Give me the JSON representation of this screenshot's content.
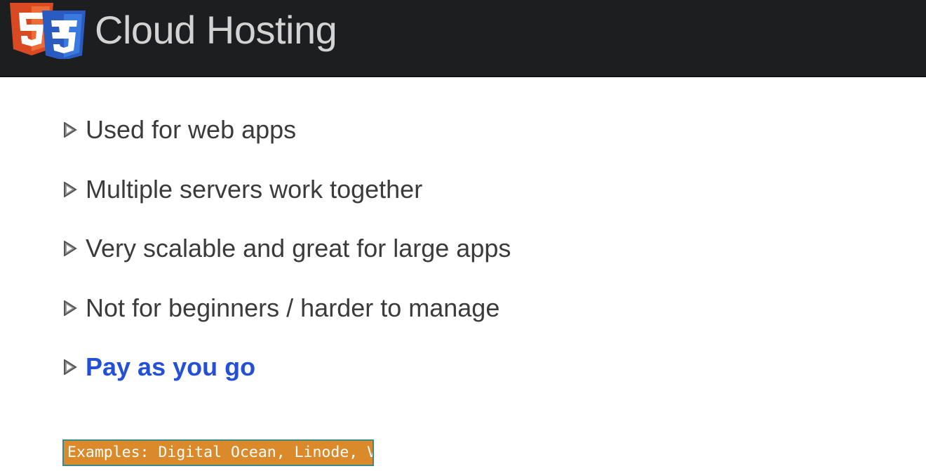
{
  "header": {
    "title": "Cloud Hosting",
    "logo_icon": "html5-css3-logo-icon",
    "background_color": "#1d1e20",
    "title_color": "#d3d3d3"
  },
  "bullets": {
    "icon": "triangle-bullet-icon",
    "items": [
      {
        "text": "Used for web apps",
        "emphasized": false
      },
      {
        "text": "Multiple servers work together",
        "emphasized": false
      },
      {
        "text": "Very scalable and great for large apps",
        "emphasized": false
      },
      {
        "text": "Not for beginners / harder to manage",
        "emphasized": false
      },
      {
        "text": "Pay as you go",
        "emphasized": true
      }
    ],
    "text_color": "#3b3b3b",
    "emphasis_color": "#2450d8"
  },
  "note": {
    "text": "Examples: Digital Ocean, Linode, Vultr",
    "background_color": "#da8a2a",
    "border_color": "#3c8a86"
  }
}
